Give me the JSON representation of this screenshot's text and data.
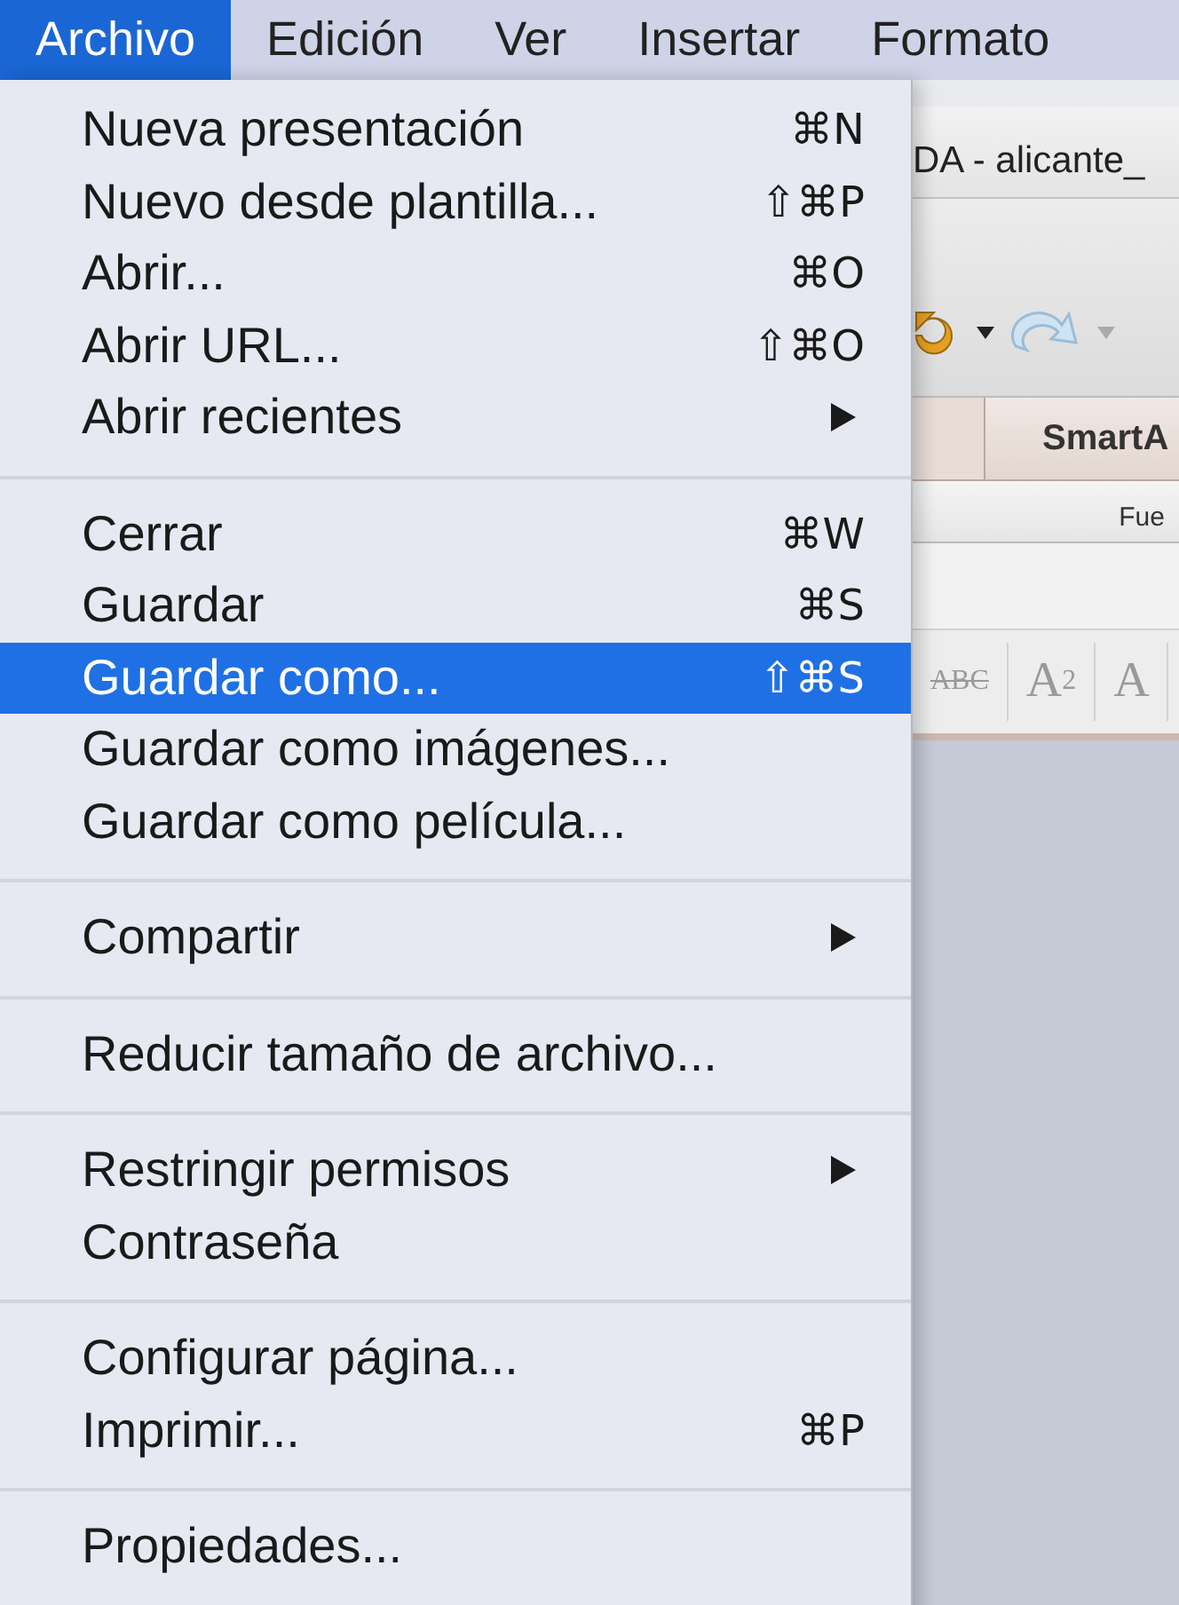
{
  "menu_bar": [
    {
      "label": "Archivo",
      "selected": true
    },
    {
      "label": "Edición",
      "selected": false
    },
    {
      "label": "Ver",
      "selected": false
    },
    {
      "label": "Insertar",
      "selected": false
    },
    {
      "label": "Formato",
      "selected": false
    }
  ],
  "background_window": {
    "title": "DA - alicante_",
    "ribbon_tab": "SmartA",
    "group_label": "Fue",
    "format_buttons": [
      "ABC",
      "A$^{2}$",
      "A"
    ]
  },
  "menu_groups": [
    {
      "items": [
        {
          "label": "Nueva presentación",
          "shortcut": "⌘N",
          "submenu": false,
          "selected": false
        },
        {
          "label": "Nuevo desde plantilla...",
          "shortcut": "⇧⌘P",
          "submenu": false,
          "selected": false
        },
        {
          "label": "Abrir...",
          "shortcut": "⌘O",
          "submenu": false,
          "selected": false
        },
        {
          "label": "Abrir URL...",
          "shortcut": "⇧⌘O",
          "submenu": false,
          "selected": false
        },
        {
          "label": "Abrir recientes",
          "submenu": true,
          "selected": false
        }
      ]
    },
    {
      "items": [
        {
          "label": "Cerrar",
          "shortcut": "⌘W",
          "submenu": false,
          "selected": false
        },
        {
          "label": "Guardar",
          "shortcut": "⌘S",
          "submenu": false,
          "selected": false
        },
        {
          "label": "Guardar como...",
          "shortcut": "⇧⌘S",
          "submenu": false,
          "selected": true
        },
        {
          "label": "Guardar como imágenes...",
          "submenu": false,
          "selected": false
        },
        {
          "label": "Guardar como película...",
          "submenu": false,
          "selected": false
        }
      ]
    },
    {
      "items": [
        {
          "label": "Compartir",
          "submenu": true,
          "selected": false
        }
      ]
    },
    {
      "items": [
        {
          "label": "Reducir tamaño de archivo...",
          "submenu": false,
          "selected": false
        }
      ]
    },
    {
      "items": [
        {
          "label": "Restringir permisos",
          "submenu": true,
          "selected": false
        },
        {
          "label": "Contraseña",
          "submenu": false,
          "selected": false
        }
      ]
    },
    {
      "items": [
        {
          "label": "Configurar página...",
          "submenu": false,
          "selected": false
        },
        {
          "label": "Imprimir...",
          "shortcut": "⌘P",
          "submenu": false,
          "selected": false
        }
      ]
    },
    {
      "items": [
        {
          "label": "Propiedades...",
          "submenu": false,
          "selected": false
        }
      ]
    }
  ]
}
